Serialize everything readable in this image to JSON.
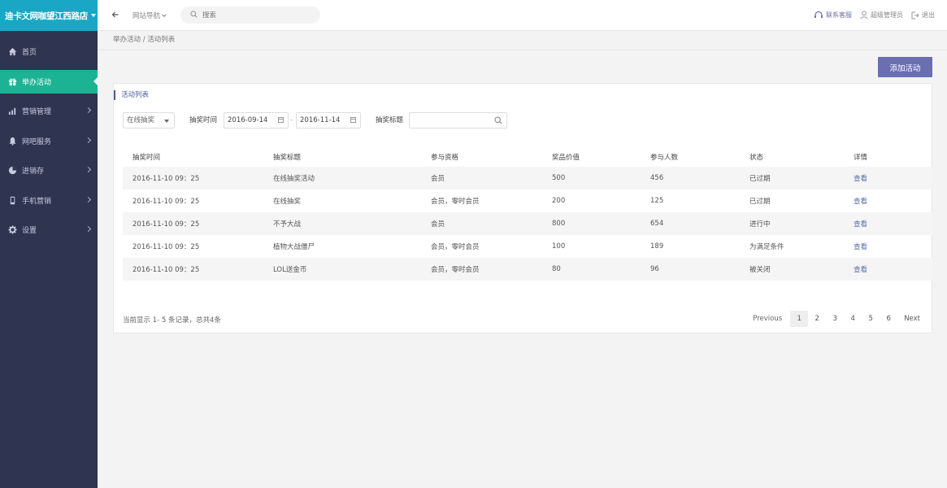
{
  "brand": {
    "title": "迪卡文网咖望江西路店"
  },
  "sidebar": {
    "items": [
      {
        "label": "首页",
        "icon": "home-icon",
        "active": false,
        "arrow": false
      },
      {
        "label": "举办活动",
        "icon": "gift-icon",
        "active": true,
        "arrow": false
      },
      {
        "label": "营销管理",
        "icon": "chart-icon",
        "active": false,
        "arrow": true
      },
      {
        "label": "网吧服务",
        "icon": "bell-icon",
        "active": false,
        "arrow": true
      },
      {
        "label": "进销存",
        "icon": "pie-icon",
        "active": false,
        "arrow": true
      },
      {
        "label": "手机营销",
        "icon": "mobile-icon",
        "active": false,
        "arrow": true
      },
      {
        "label": "设置",
        "icon": "gear-icon",
        "active": false,
        "arrow": true
      }
    ]
  },
  "topbar": {
    "site_nav": "网站导航",
    "search_placeholder": "搜索",
    "service": "联系客服",
    "user": "超级管理员",
    "logout": "退出"
  },
  "breadcrumb": "举办活动 / 活动列表",
  "actions": {
    "add_label": "添加活动"
  },
  "card": {
    "title": "活动列表"
  },
  "filters": {
    "type_value": "在线抽奖",
    "time_label": "抽奖时间",
    "date_from": "2016-09-14",
    "date_sep": "-",
    "date_to": "2016-11-14",
    "title_label": "抽奖标题",
    "title_value": ""
  },
  "table": {
    "headers": [
      "抽奖时间",
      "抽奖标题",
      "参与资格",
      "奖品价值",
      "参与人数",
      "状态",
      "详情"
    ],
    "rows": [
      [
        "2016-11-10 09：25",
        "在线抽奖活动",
        "会员",
        "500",
        "456",
        "已过期",
        "查看"
      ],
      [
        "2016-11-10 09：25",
        "在线抽奖",
        "会员，零时会员",
        "200",
        "125",
        "已过期",
        "查看"
      ],
      [
        "2016-11-10 09：25",
        "不予大战",
        "会员",
        "800",
        "654",
        "进行中",
        "查看"
      ],
      [
        "2016-11-10 09：25",
        "植物大战僵尸",
        "会员，零时会员",
        "100",
        "189",
        "为满足条件",
        "查看"
      ],
      [
        "2016-11-10 09：25",
        "LOL送金币",
        "会员，零时会员",
        "80",
        "96",
        "被关闭",
        "查看"
      ]
    ]
  },
  "pagination": {
    "summary": "当前显示 1- 5 条记录，总共4条",
    "prev": "Previous",
    "pages": [
      "1",
      "2",
      "3",
      "4",
      "5",
      "6"
    ],
    "current": "1",
    "next": "Next"
  },
  "colors": {
    "sidebar_bg": "#2f3451",
    "brand_bg": "#1aa7c5",
    "active_bg": "#1cb394",
    "accent": "#6a6fb2"
  }
}
